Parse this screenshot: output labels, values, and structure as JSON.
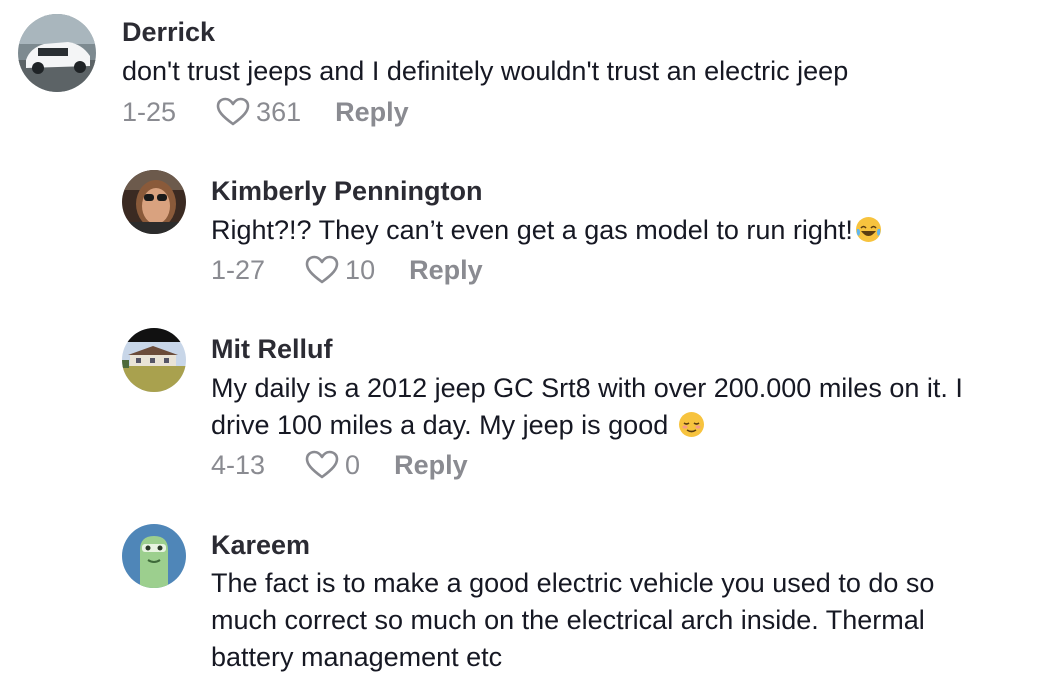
{
  "comments": [
    {
      "username": "Derrick",
      "text": "don't trust jeeps and I definitely wouldn't trust an electric jeep",
      "date": "1-25",
      "likes": "361",
      "reply_label": "Reply",
      "avatar": "car-avatar"
    },
    {
      "username": "Kimberly Pennington",
      "text": "Right?!? They can’t even get a gas model to run right!",
      "emoji": "laughing-tears-emoji",
      "date": "1-27",
      "likes": "10",
      "reply_label": "Reply",
      "avatar": "woman-sunglasses-avatar"
    },
    {
      "username": "Mit Relluf",
      "text_line1": "My daily is a 2012 jeep GC Srt8 with over 200.000 miles on it. I",
      "text_line2": "drive 100 miles a day. My jeep is good ",
      "emoji": "relieved-face-emoji",
      "date": "4-13",
      "likes": "0",
      "reply_label": "Reply",
      "avatar": "house-landscape-avatar"
    },
    {
      "username": "Kareem",
      "text_line1": "The fact is to make a good electric vehicle you used to do so",
      "text_line2": "much correct so much on the electrical arch inside. Thermal",
      "text_line3": "battery management etc",
      "avatar": "green-creature-avatar"
    }
  ],
  "colors": {
    "text": "#161823",
    "username": "#2b2b33",
    "meta": "#8a8b91",
    "background": "#ffffff"
  },
  "icons": {
    "like": "heart-outline-icon"
  }
}
